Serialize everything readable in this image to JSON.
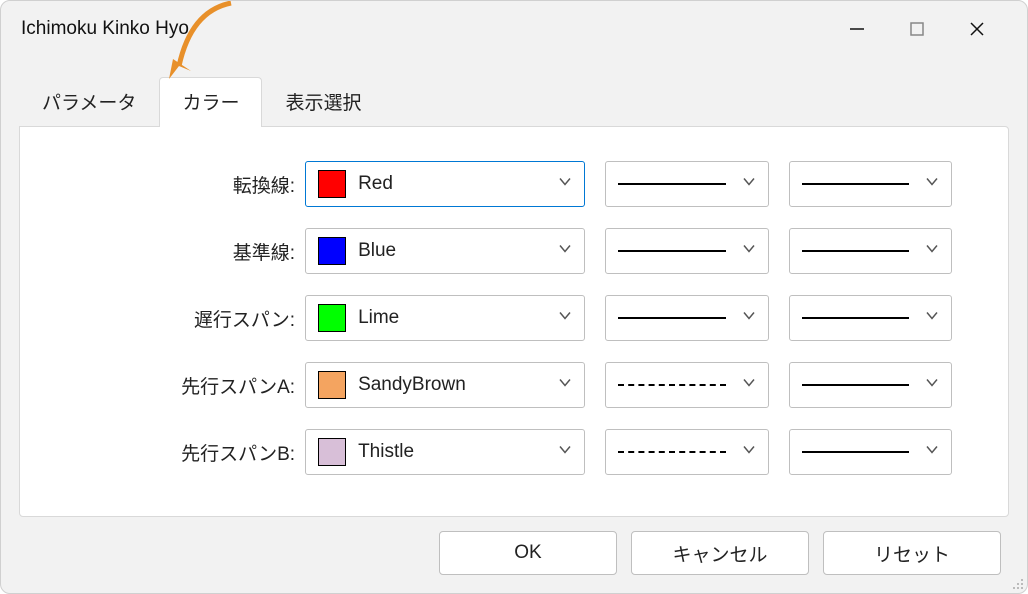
{
  "window": {
    "title": "Ichimoku Kinko Hyo"
  },
  "tabs": {
    "param": "パラメータ",
    "color": "カラー",
    "display": "表示選択"
  },
  "rows": [
    {
      "label": "転換線:",
      "color_name": "Red",
      "swatch": "#ff0000",
      "style": "solid"
    },
    {
      "label": "基準線:",
      "color_name": "Blue",
      "swatch": "#0000ff",
      "style": "solid"
    },
    {
      "label": "遅行スパン:",
      "color_name": "Lime",
      "swatch": "#00ff00",
      "style": "solid"
    },
    {
      "label": "先行スパンA:",
      "color_name": "SandyBrown",
      "swatch": "#f4a460",
      "style": "dashed"
    },
    {
      "label": "先行スパンB:",
      "color_name": "Thistle",
      "swatch": "#d8bfd8",
      "style": "dashed"
    }
  ],
  "buttons": {
    "ok": "OK",
    "cancel": "キャンセル",
    "reset": "リセット"
  }
}
